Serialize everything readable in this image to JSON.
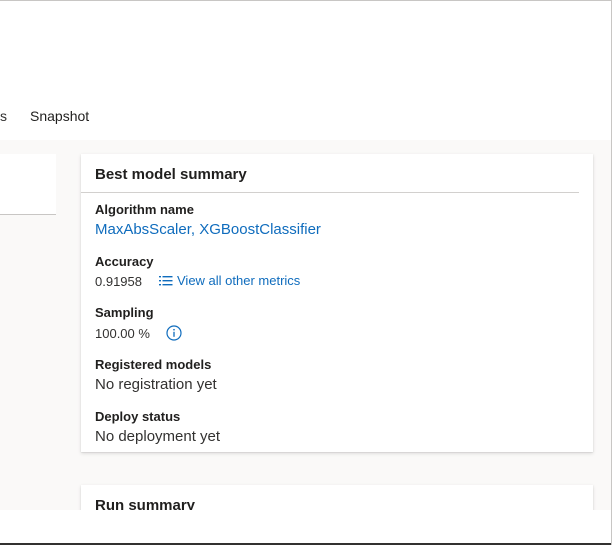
{
  "tabs": {
    "partial_label": "s",
    "snapshot_label": "Snapshot"
  },
  "best_model_summary": {
    "title": "Best model summary",
    "algorithm_name": {
      "label": "Algorithm name",
      "value": "MaxAbsScaler, XGBoostClassifier"
    },
    "accuracy": {
      "label": "Accuracy",
      "value": "0.91958",
      "metrics_link": "View all other metrics",
      "metrics_icon": "list-icon"
    },
    "sampling": {
      "label": "Sampling",
      "value": "100.00 %",
      "info_icon": "info-icon"
    },
    "registered_models": {
      "label": "Registered models",
      "value": "No registration yet"
    },
    "deploy_status": {
      "label": "Deploy status",
      "value": "No deployment yet"
    }
  },
  "run_summary": {
    "title": "Run summary"
  },
  "colors": {
    "link": "#0f6cbd",
    "text": "#201f1e",
    "background": "#faf9f8"
  }
}
